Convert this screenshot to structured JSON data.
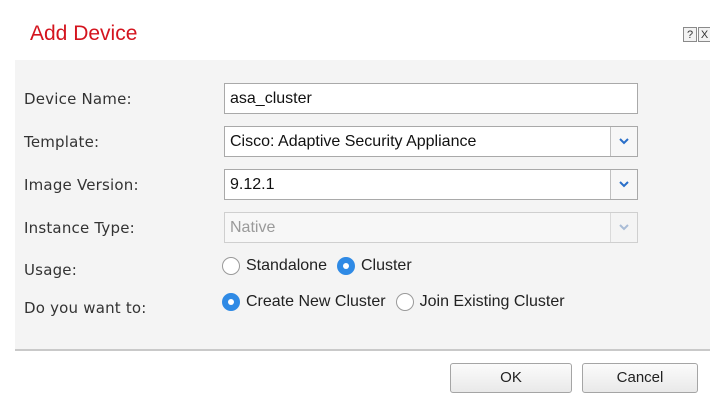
{
  "dialog": {
    "title": "Add Device",
    "help_label": "?",
    "close_label": "X"
  },
  "form": {
    "device_name": {
      "label": "Device Name:",
      "value": "asa_cluster"
    },
    "template": {
      "label": "Template:",
      "value": "Cisco: Adaptive Security Appliance"
    },
    "image_version": {
      "label": "Image Version:",
      "value": "9.12.1"
    },
    "instance_type": {
      "label": "Instance Type:",
      "value": "Native",
      "disabled": true
    },
    "usage": {
      "label": "Usage:",
      "options": [
        "Standalone",
        "Cluster"
      ],
      "selected": "Cluster"
    },
    "do_you_want_to": {
      "label": "Do you want to:",
      "options": [
        "Create New Cluster",
        "Join Existing Cluster"
      ],
      "selected": "Create New Cluster"
    }
  },
  "buttons": {
    "ok": "OK",
    "cancel": "Cancel"
  },
  "colors": {
    "title": "#d4141e",
    "radio_selected": "#2f8ae5",
    "dropdown_arrow": "#2a6fc9"
  },
  "icons": {
    "dropdown": "chevron-down-icon"
  }
}
